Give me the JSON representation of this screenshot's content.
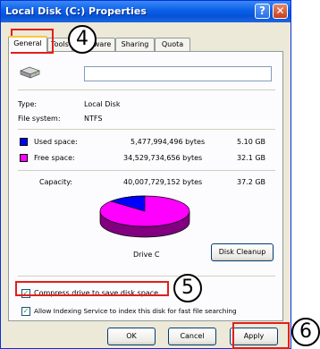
{
  "window": {
    "title": "Local Disk (C:) Properties"
  },
  "titlebar": {
    "help_glyph": "?",
    "close_glyph": "✕"
  },
  "tabs": [
    {
      "label": "General",
      "active": true
    },
    {
      "label": "Tools",
      "active": false
    },
    {
      "label": "Hardware",
      "active": false
    },
    {
      "label": "Sharing",
      "active": false
    },
    {
      "label": "Quota",
      "active": false
    }
  ],
  "general": {
    "name_value": "",
    "type_label": "Type:",
    "type_value": "Local Disk",
    "fs_label": "File system:",
    "fs_value": "NTFS",
    "used_label": "Used space:",
    "used_bytes": "5,477,994,496 bytes",
    "used_gb": "5.10 GB",
    "free_label": "Free space:",
    "free_bytes": "34,529,734,656 bytes",
    "free_gb": "32.1 GB",
    "capacity_label": "Capacity:",
    "capacity_bytes": "40,007,729,152 bytes",
    "capacity_gb": "37.2 GB",
    "drive_label": "Drive C",
    "disk_cleanup_label": "Disk Cleanup",
    "compress_label": "Compress drive to save disk space",
    "compress_checked": true,
    "indexing_label": "Allow Indexing Service to index this disk for fast file searching",
    "indexing_checked": true
  },
  "buttons": {
    "ok": "OK",
    "cancel": "Cancel",
    "apply": "Apply"
  },
  "annotations": {
    "four": "4",
    "five": "5",
    "six": "6"
  },
  "colors": {
    "used": "#0000ff",
    "free": "#ff00ff"
  },
  "usage": {
    "used_fraction": 0.137,
    "free_fraction": 0.863
  }
}
